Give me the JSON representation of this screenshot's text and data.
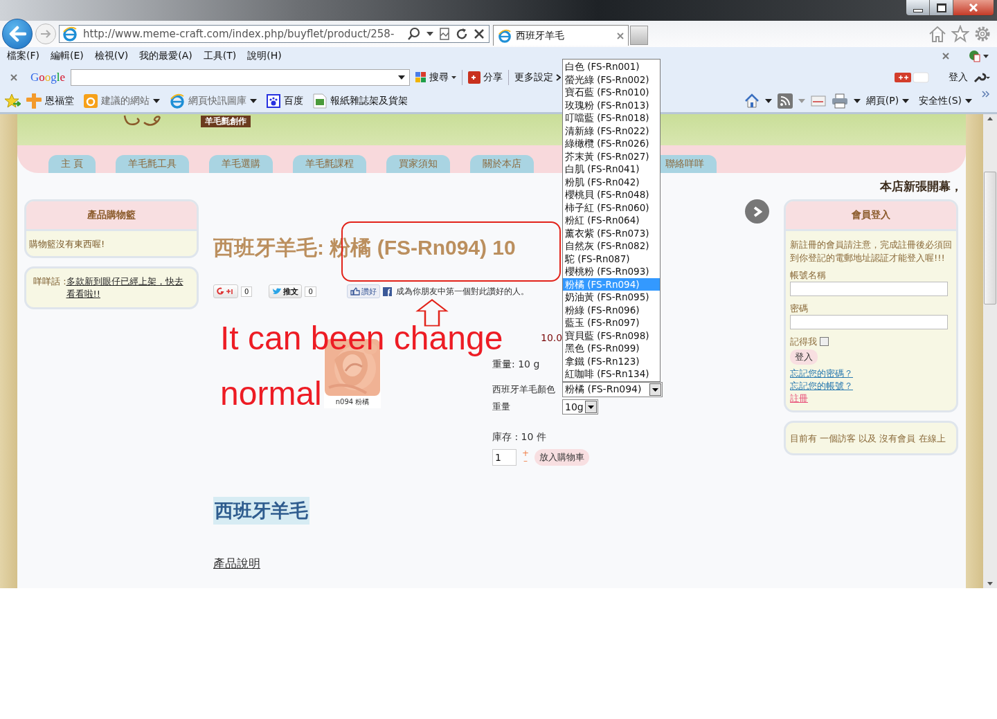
{
  "window": {
    "address": "http://www.meme-craft.com/index.php/buyflet/product/258-",
    "tab_title": "西班牙羊毛"
  },
  "menu_bar": [
    "檔案(F)",
    "編輯(E)",
    "檢視(V)",
    "我的最愛(A)",
    "工具(T)",
    "說明(H)"
  ],
  "google_toolbar": {
    "logo": "Google",
    "search_label": "搜尋",
    "share_label": "分享",
    "more_label": "更多設定",
    "sign_in": "登入"
  },
  "favorites_bar": [
    {
      "label": "恩福堂",
      "dropdown": false,
      "kind": "cross"
    },
    {
      "label": "建議的網站",
      "dropdown": true,
      "kind": "bing"
    },
    {
      "label": "網頁快訊圖庫",
      "dropdown": true,
      "kind": "ie"
    },
    {
      "label": "百度",
      "dropdown": false,
      "kind": "paw"
    },
    {
      "label": "報紙雜誌架及貨架",
      "dropdown": false,
      "kind": "shop"
    }
  ],
  "command_bar": [
    "網頁(P)",
    "安全性(S)"
  ],
  "page": {
    "header_badge": "羊毛氈創作",
    "nav_tabs": [
      "主 頁",
      "羊毛氈工具",
      "羊毛選購",
      "羊毛氈課程",
      "買家須知",
      "關於本店",
      "聯絡咩咩"
    ],
    "marquee": "本店新張開幕，",
    "cart": {
      "title": "產品購物籃",
      "empty_text": "購物籃沒有東西喔!"
    },
    "news": {
      "label": "咩咩話 : ",
      "link": "多款新到眼仔已經上架，快去看看啦!!"
    },
    "product": {
      "title": "西班牙羊毛: 粉橘 (FS-Rn094) 10",
      "gplus_count": "0",
      "tweet_label": "推文",
      "tweet_count": "0",
      "like_label": "讚好",
      "like_text": "成為你朋友中第一個對此讚好的人。",
      "image_caption": "n094  粉橘",
      "price": "10.0",
      "weight_text": "重量: 10 g",
      "options": [
        {
          "label": "西班牙羊毛顏色",
          "value": "粉橘 (FS-Rn094)"
        },
        {
          "label": "重量",
          "value": "10g"
        }
      ],
      "stock": "庫存 : 10 件",
      "quantity": "1",
      "plus": "+",
      "minus": "–",
      "add_to_cart": "放入購物車",
      "section_title": "西班牙羊毛",
      "description_link": "產品說明"
    },
    "login": {
      "title": "會員登入",
      "notice": "新註冊的會員請注意，完成註冊後必須回到你登記的電郵地址認証才能登入喔!!!",
      "username_label": "帳號名稱",
      "password_label": "密碼",
      "remember_label": "記得我",
      "remember_checked": false,
      "submit": "登入",
      "links": [
        {
          "label": "忘記您的密碼？",
          "kind": "help"
        },
        {
          "label": "忘記您的帳號？",
          "kind": "help"
        },
        {
          "label": "註冊",
          "kind": "register"
        }
      ]
    },
    "online": "目前有 一個訪客 以及 沒有會員 在線上"
  },
  "dropdown": [
    {
      "label": "白色 (FS-Rn001)",
      "selected": false
    },
    {
      "label": "螢光綠 (FS-Rn002)",
      "selected": false
    },
    {
      "label": "寶石藍 (FS-Rn010)",
      "selected": false
    },
    {
      "label": "玫瑰粉 (FS-Rn013)",
      "selected": false
    },
    {
      "label": "叮噹藍 (FS-Rn018)",
      "selected": false
    },
    {
      "label": "清新綠 (FS-Rn022)",
      "selected": false
    },
    {
      "label": "綠橄欖 (FS-Rn026)",
      "selected": false
    },
    {
      "label": "芥末黃 (FS-Rn027)",
      "selected": false
    },
    {
      "label": "白肌 (FS-Rn041)",
      "selected": false
    },
    {
      "label": "粉肌 (FS-Rn042)",
      "selected": false
    },
    {
      "label": "櫻桃貝 (FS-Rn048)",
      "selected": false
    },
    {
      "label": "柿子紅 (FS-Rn060)",
      "selected": false
    },
    {
      "label": "粉紅 (FS-Rn064)",
      "selected": false
    },
    {
      "label": "薰衣紫 (FS-Rn073)",
      "selected": false
    },
    {
      "label": "自然灰 (FS-Rn082)",
      "selected": false
    },
    {
      "label": "駝 (FS-Rn087)",
      "selected": false
    },
    {
      "label": "櫻桃粉 (FS-Rn093)",
      "selected": false
    },
    {
      "label": "粉橘 (FS-Rn094)",
      "selected": true
    },
    {
      "label": "奶油黃 (FS-Rn095)",
      "selected": false
    },
    {
      "label": "粉綠 (FS-Rn096)",
      "selected": false
    },
    {
      "label": "藍玉 (FS-Rn097)",
      "selected": false
    },
    {
      "label": "寶貝藍 (FS-Rn098)",
      "selected": false
    },
    {
      "label": "黑色 (FS-Rn099)",
      "selected": false
    },
    {
      "label": "拿鐵 (FS-Rn123)",
      "selected": false
    },
    {
      "label": "紅咖啡 (FS-Rn134)",
      "selected": false
    }
  ],
  "annotation": {
    "lines": [
      "It can been change",
      "normal"
    ]
  }
}
